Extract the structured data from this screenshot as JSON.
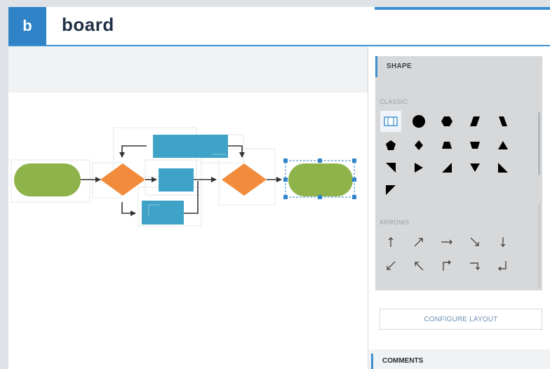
{
  "header": {
    "logo_letter": "b",
    "brand_name": "board",
    "accent_color": "#2f83c6"
  },
  "shape_panel": {
    "title": "SHAPE",
    "classic_label": "CLASSIC",
    "classic_shapes": [
      "split-rectangle-icon",
      "circle-icon",
      "hexagon-icon",
      "parallelogram-icon",
      "slanted-quad-icon",
      "pentagon-icon",
      "diamond-icon",
      "trapezoid-icon",
      "inverted-trapezoid-icon",
      "triangle-up-icon",
      "right-triangle-down-icon",
      "triangle-right-icon",
      "right-triangle-up-icon",
      "triangle-down-icon",
      "right-triangle-left-icon",
      "corner-triangle-icon"
    ],
    "arrows_label": "ARROWS",
    "arrow_shapes": [
      "arrow-up-icon",
      "arrow-up-right-icon",
      "arrow-right-icon",
      "arrow-down-right-icon",
      "arrow-down-icon",
      "arrow-down-left-icon",
      "arrow-up-left-icon",
      "elbow-up-right-icon",
      "elbow-right-down-icon",
      "elbow-down-left-icon"
    ],
    "configure_label": "CONFIGURE LAYOUT"
  },
  "comments": {
    "title": "COMMENTS"
  },
  "flowchart": {
    "terminal_color": "#8db34a",
    "decision_color": "#f28c3c",
    "process_color": "#3ea3c6",
    "selection_color": "#2f83c6"
  }
}
